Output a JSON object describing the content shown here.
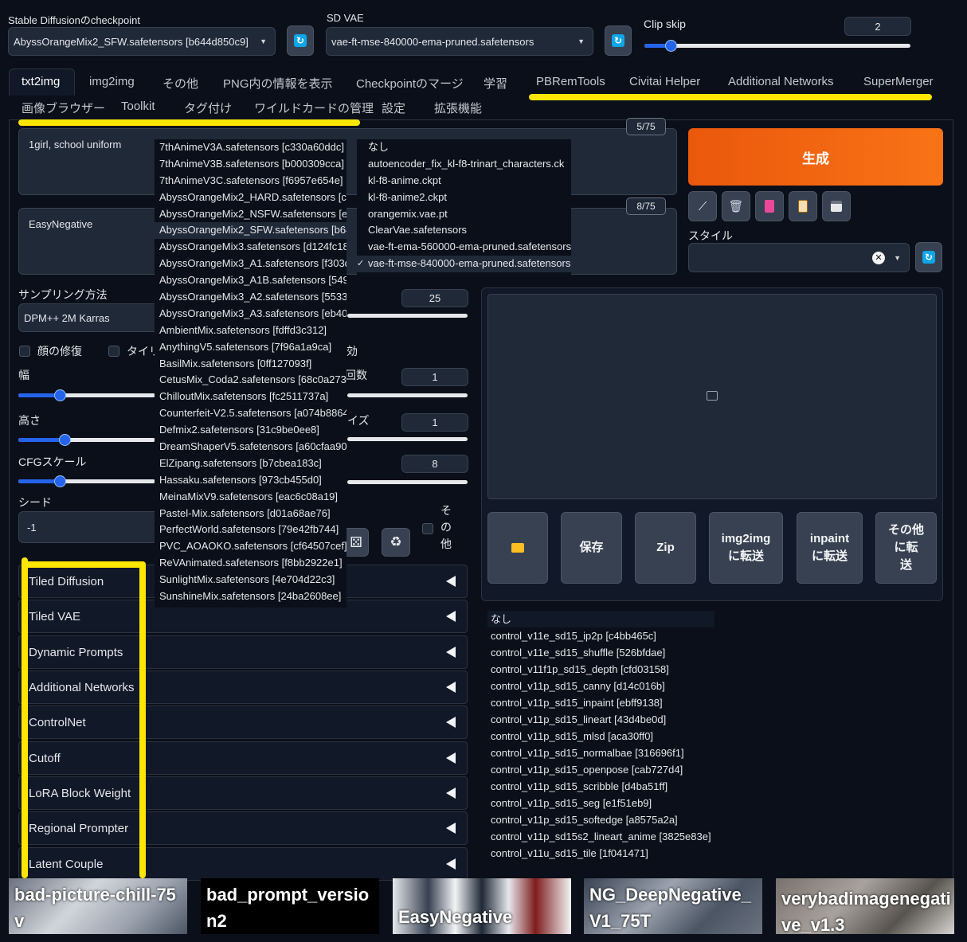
{
  "top": {
    "checkpoint_label": "Stable Diffusionのcheckpoint",
    "checkpoint_value": "AbyssOrangeMix2_SFW.safetensors [b644d850c9]",
    "vae_label": "SD VAE",
    "vae_value": "vae-ft-mse-840000-ema-pruned.safetensors",
    "clip_skip_label": "Clip skip",
    "clip_skip_value": "2",
    "clip_skip_fraction": 0.1
  },
  "tabs_row1": [
    "txt2img",
    "img2img",
    "その他",
    "PNG内の情報を表示",
    "Checkpointのマージ",
    "学習",
    "PBRemTools",
    "Civitai Helper",
    "Additional Networks",
    "SuperMerger"
  ],
  "tabs_row2": [
    "画像ブラウザー",
    "Toolkit",
    "タグ付け",
    "ワイルドカードの管理",
    "設定",
    "拡張機能"
  ],
  "prompt": {
    "positive_text": "1girl, school uniform",
    "positive_counter": "5/75",
    "negative_text": "EasyNegative",
    "negative_counter": "8/75"
  },
  "generate_label": "生成",
  "style_label": "スタイル",
  "sampling": {
    "label": "サンプリング方法",
    "value": "DPM++ 2M Karras",
    "steps_value": "25"
  },
  "checks": {
    "face_restore": "顔の修復",
    "tiling": "タイリ",
    "hires_partial": "効"
  },
  "width": {
    "label": "幅",
    "fraction": 0.3
  },
  "height": {
    "label": "高さ",
    "fraction": 0.34
  },
  "batch_count": {
    "label_partial": "回数",
    "value": "1"
  },
  "batch_size": {
    "label_partial": "イズ",
    "value": "1"
  },
  "cfg": {
    "label": "CFGスケール",
    "value": "8",
    "fraction": 0.3
  },
  "seed": {
    "label": "シード",
    "value": "-1",
    "extra_label": "その他"
  },
  "accordions": [
    "Tiled Diffusion",
    "Tiled VAE",
    "Dynamic Prompts",
    "Additional Networks",
    "ControlNet",
    "Cutoff",
    "LoRA Block Weight",
    "Regional Prompter",
    "Latent Couple"
  ],
  "checkpoint_dropdown": [
    "7thAnimeV3A.safetensors [c330a60ddc]",
    "7thAnimeV3B.safetensors [b000309cca]",
    "7thAnimeV3C.safetensors [f6957e654e]",
    "AbyssOrangeMix2_HARD.safetensors [ca",
    "AbyssOrangeMix2_NSFW.safetensors [e8",
    "AbyssOrangeMix2_SFW.safetensors [b64",
    "AbyssOrangeMix3.safetensors [d124fc18",
    "AbyssOrangeMix3_A1.safetensors [f303d",
    "AbyssOrangeMix3_A1B.safetensors [5493",
    "AbyssOrangeMix3_A2.safetensors [55339",
    "AbyssOrangeMix3_A3.safetensors [eb405",
    "AmbientMix.safetensors [fdffd3c312]",
    "AnythingV5.safetensors [7f96a1a9ca]",
    "BasilMix.safetensors [0ff127093f]",
    "CetusMix_Coda2.safetensors [68c0a2738",
    "ChilloutMix.safetensors [fc2511737a]",
    "Counterfeit-V2.5.safetensors [a074b8864",
    "Defmix2.safetensors [31c9be0ee8]",
    "DreamShaperV5.safetensors [a60cfaa90c",
    "ElZipang.safetensors [b7cbea183c]",
    "Hassaku.safetensors [973cb455d0]",
    "MeinaMixV9.safetensors [eac6c08a19]",
    "Pastel-Mix.safetensors [d01a68ae76]",
    "PerfectWorld.safetensors [79e42fb744]",
    "PVC_AOAOKO.safetensors [cf64507cef]",
    "ReVAnimated.safetensors [f8bb2922e1]",
    "SunlightMix.safetensors [4e704d22c3]",
    "SunshineMix.safetensors [24ba2608ee]"
  ],
  "vae_dropdown": [
    "なし",
    "autoencoder_fix_kl-f8-trinart_characters.ck",
    "kl-f8-anime.ckpt",
    "kl-f8-anime2.ckpt",
    "orangemix.vae.pt",
    "ClearVae.safetensors",
    "vae-ft-ema-560000-ema-pruned.safetensors",
    "vae-ft-mse-840000-ema-pruned.safetensors"
  ],
  "vae_check_mark": "✓",
  "output_buttons": [
    "保存",
    "Zip",
    "img2img\nに転送",
    "inpaint\nに転送",
    "その他\nに転\n送"
  ],
  "controlnet_models": [
    "なし",
    "control_v11e_sd15_ip2p [c4bb465c]",
    "control_v11e_sd15_shuffle [526bfdae]",
    "control_v11f1p_sd15_depth [cfd03158]",
    "control_v11p_sd15_canny [d14c016b]",
    "control_v11p_sd15_inpaint [ebff9138]",
    "control_v11p_sd15_lineart [43d4be0d]",
    "control_v11p_sd15_mlsd [aca30ff0]",
    "control_v11p_sd15_normalbae [316696f1]",
    "control_v11p_sd15_openpose [cab727d4]",
    "control_v11p_sd15_scribble [d4ba51ff]",
    "control_v11p_sd15_seg [e1f51eb9]",
    "control_v11p_sd15_softedge [a8575a2a]",
    "control_v11p_sd15s2_lineart_anime [3825e83e]",
    "control_v11u_sd15_tile [1f041471]"
  ],
  "embeddings": [
    "bad-picture-chill-75v",
    "bad_prompt_version2",
    "EasyNegative",
    "NG_DeepNegative_V1_75T",
    "verybadimagenegative_v1.3"
  ],
  "icons": {
    "refresh": "refresh-icon",
    "image_placeholder": "image-icon",
    "folder": "folder-icon",
    "dice": "dice-icon",
    "recycle": "recycle-icon"
  },
  "colors": {
    "generate": "#f97316",
    "accent": "#2563eb",
    "highlight": "#ffe600",
    "background": "#0b0f19"
  }
}
